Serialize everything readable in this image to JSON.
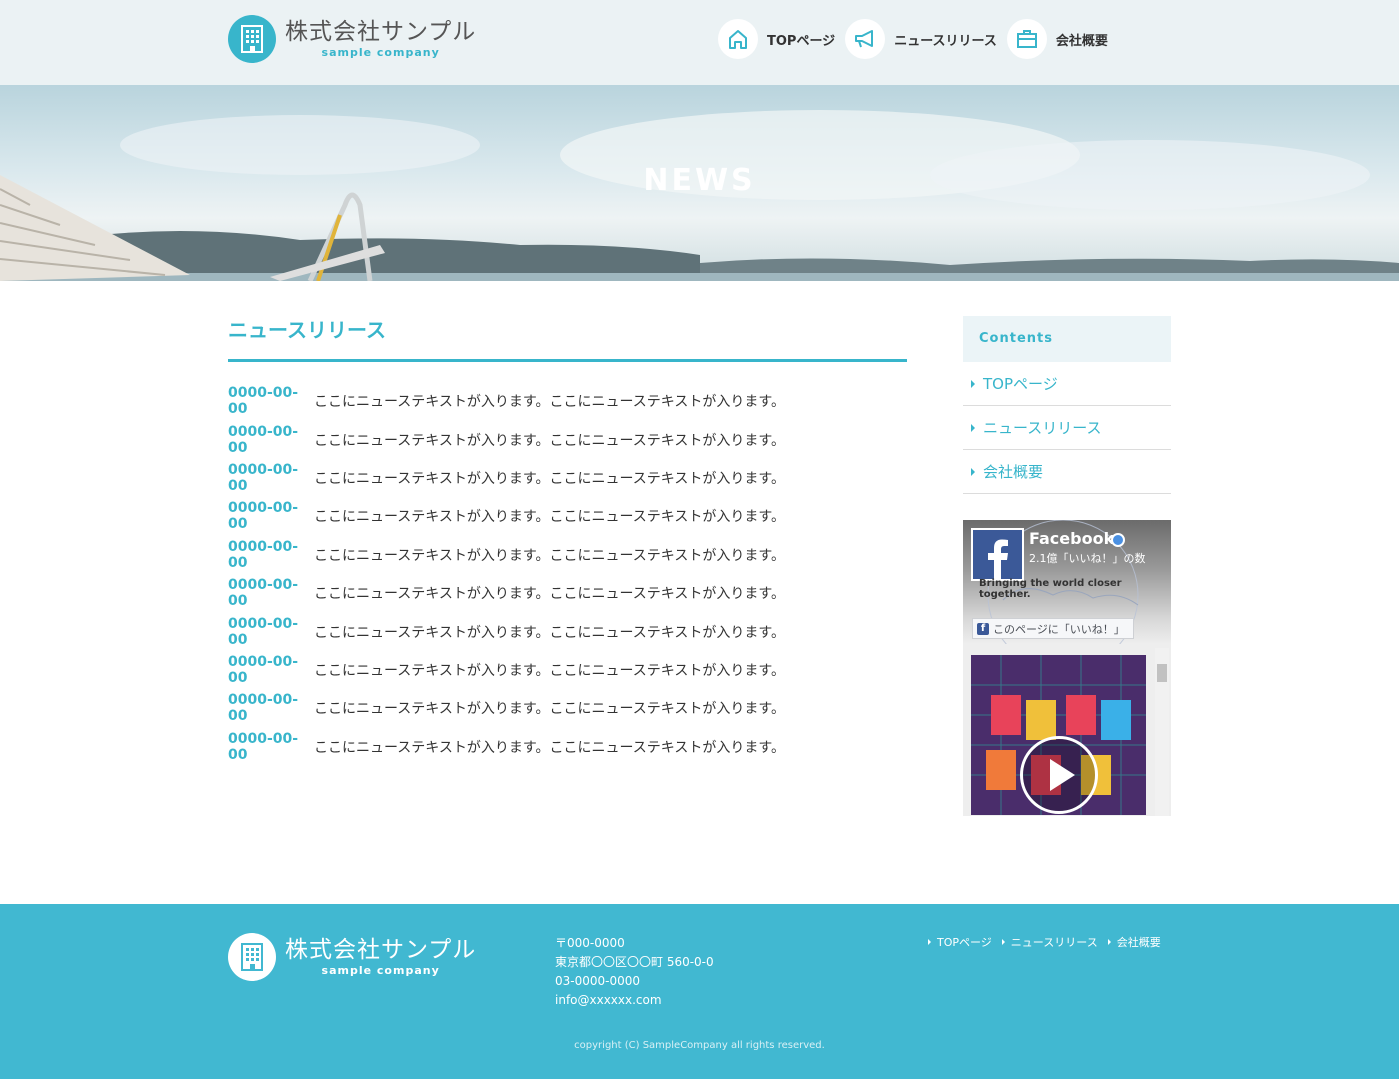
{
  "colors": {
    "accent": "#38b5cb",
    "header_bg": "#ebf2f4",
    "footer_bg": "#41b8d1"
  },
  "header": {
    "logo": {
      "jp": "株式会社サンプル",
      "en": "sample company",
      "icon": "building-icon"
    },
    "nav": [
      {
        "label": "TOPページ",
        "icon": "home-icon"
      },
      {
        "label": "ニュースリリース",
        "icon": "megaphone-icon"
      },
      {
        "label": "会社概要",
        "icon": "briefcase-icon"
      }
    ]
  },
  "hero": {
    "title": "NEWS"
  },
  "main": {
    "title": "ニュースリリース",
    "news": [
      {
        "date": "0000-00-00",
        "text": "ここにニューステキストが入ります。ここにニューステキストが入ります。"
      },
      {
        "date": "0000-00-00",
        "text": "ここにニューステキストが入ります。ここにニューステキストが入ります。"
      },
      {
        "date": "0000-00-00",
        "text": "ここにニューステキストが入ります。ここにニューステキストが入ります。"
      },
      {
        "date": "0000-00-00",
        "text": "ここにニューステキストが入ります。ここにニューステキストが入ります。"
      },
      {
        "date": "0000-00-00",
        "text": "ここにニューステキストが入ります。ここにニューステキストが入ります。"
      },
      {
        "date": "0000-00-00",
        "text": "ここにニューステキストが入ります。ここにニューステキストが入ります。"
      },
      {
        "date": "0000-00-00",
        "text": "ここにニューステキストが入ります。ここにニューステキストが入ります。"
      },
      {
        "date": "0000-00-00",
        "text": "ここにニューステキストが入ります。ここにニューステキストが入ります。"
      },
      {
        "date": "0000-00-00",
        "text": "ここにニューステキストが入ります。ここにニューステキストが入ります。"
      },
      {
        "date": "0000-00-00",
        "text": "ここにニューステキストが入ります。ここにニューステキストが入ります。"
      }
    ]
  },
  "sidebar": {
    "heading": "Contents",
    "items": [
      "TOPページ",
      "ニュースリリース",
      "会社概要"
    ],
    "facebook": {
      "name": "Facebook",
      "likes": "2.1億「いいね！」の数",
      "slogan": "Bringing the world closer together.",
      "like_button": "このページに「いいね！」"
    }
  },
  "footer": {
    "logo": {
      "jp": "株式会社サンプル",
      "en": "sample company"
    },
    "address": [
      "〒000-0000",
      "東京都〇〇区〇〇町 560-0-0",
      "03-0000-0000",
      "info@xxxxxx.com"
    ],
    "nav": [
      "TOPページ",
      "ニュースリリース",
      "会社概要"
    ],
    "copyright": "copyright (C) SampleCompany all rights reserved."
  }
}
